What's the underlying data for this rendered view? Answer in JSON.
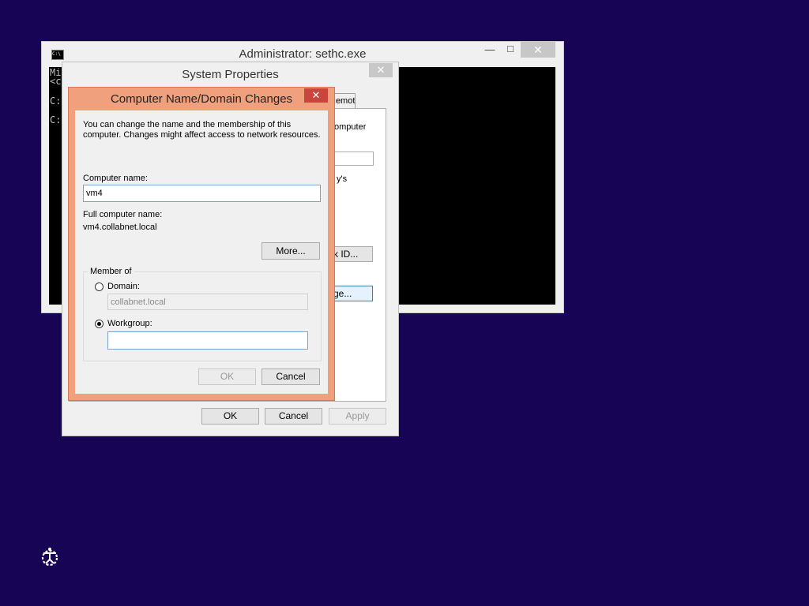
{
  "cmd_window": {
    "title": "Administrator: sethc.exe",
    "icon_text": "C:\\",
    "minimize_glyph": "—",
    "maximize_glyph": "□",
    "close_glyph": "✕",
    "lines": [
      "Mi",
      "<c",
      "C:",
      "C:"
    ]
  },
  "system_properties": {
    "title": "System Properties",
    "close_glyph": "✕",
    "tab_remote": "Remote",
    "fragment_computer": "omputer",
    "fragment_ys": "y's",
    "fragment_network_id": "k ID...",
    "fragment_change": "ge...",
    "ok_label": "OK",
    "cancel_label": "Cancel",
    "apply_label": "Apply"
  },
  "name_dialog": {
    "title": "Computer Name/Domain Changes",
    "close_glyph": "✕",
    "description_line1": "You can change the name and the membership of this",
    "description_line2": "computer. Changes might affect access to network resources.",
    "computer_name_label": "Computer name:",
    "computer_name_value": "vm4",
    "full_name_label": "Full computer name:",
    "full_name_value": "vm4.collabnet.local",
    "more_label": "More...",
    "member_of_label": "Member of",
    "domain_label": "Domain:",
    "domain_value": "collabnet.local",
    "workgroup_label": "Workgroup:",
    "workgroup_value": "",
    "ok_label": "OK",
    "cancel_label": "Cancel",
    "selected_membership": "workgroup"
  },
  "colors": {
    "desktop_background": "#180454",
    "dialog_accent": "#f0a07d",
    "close_button_active": "#c9463d"
  },
  "taskbar_icons": [
    "ease-of-access-icon"
  ]
}
